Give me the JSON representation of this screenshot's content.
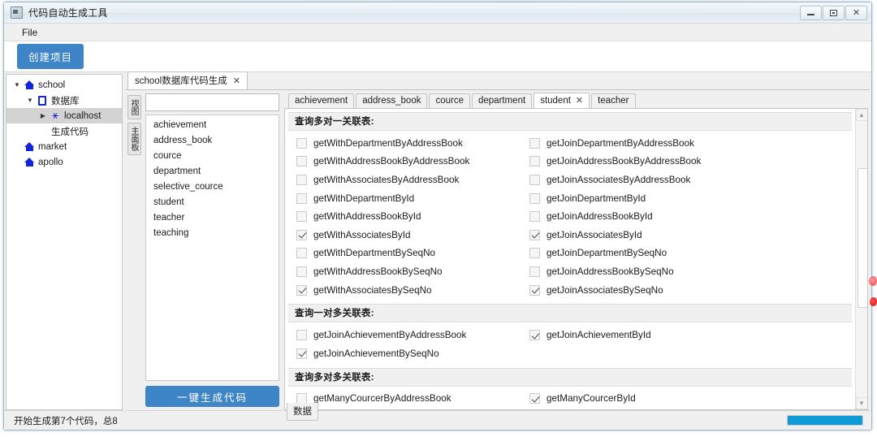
{
  "window": {
    "title": "代码自动生成工具",
    "icon": "app-icon",
    "controls": {
      "minimize": "—",
      "maximize": "□",
      "close": "✕"
    }
  },
  "menubar": {
    "items": [
      "File"
    ]
  },
  "toolbar": {
    "create_project_label": "创建项目"
  },
  "sidebar": {
    "items": [
      {
        "label": "school",
        "icon": "house-icon",
        "indent": 0,
        "twisty": "▼",
        "selected": false
      },
      {
        "label": "数据库",
        "icon": "database-icon",
        "indent": 1,
        "twisty": "▼",
        "selected": false
      },
      {
        "label": "localhost",
        "icon": "plug-icon",
        "indent": 2,
        "twisty": "▶",
        "selected": true
      },
      {
        "label": "生成代码",
        "icon": "none",
        "indent": 1,
        "twisty": "",
        "selected": false
      },
      {
        "label": "market",
        "icon": "house-icon",
        "indent": 0,
        "twisty": "",
        "selected": false
      },
      {
        "label": "apollo",
        "icon": "house-icon",
        "indent": 0,
        "twisty": "",
        "selected": false
      }
    ]
  },
  "doc_tab": {
    "label": "school数据库代码生成",
    "close": "✕"
  },
  "vertical_tabs": [
    "视图",
    "主面板"
  ],
  "table_list": {
    "search_value": "",
    "search_placeholder": "",
    "items": [
      "achievement",
      "address_book",
      "cource",
      "department",
      "selective_cource",
      "student",
      "teacher",
      "teaching"
    ],
    "generate_button_label": "一键生成代码"
  },
  "method_tabs": [
    {
      "label": "achievement",
      "active": false,
      "closable": false
    },
    {
      "label": "address_book",
      "active": false,
      "closable": false
    },
    {
      "label": "cource",
      "active": false,
      "closable": false
    },
    {
      "label": "department",
      "active": false,
      "closable": false
    },
    {
      "label": "student",
      "active": true,
      "closable": true,
      "close": "✕"
    },
    {
      "label": "teacher",
      "active": false,
      "closable": false
    }
  ],
  "method_sections": [
    {
      "header": "查询多对一关联表:",
      "rows": [
        {
          "left": {
            "label": "getWithDepartmentByAddressBook",
            "checked": false
          },
          "right": {
            "label": "getJoinDepartmentByAddressBook",
            "checked": false
          }
        },
        {
          "left": {
            "label": "getWithAddressBookByAddressBook",
            "checked": false
          },
          "right": {
            "label": "getJoinAddressBookByAddressBook",
            "checked": false
          }
        },
        {
          "left": {
            "label": "getWithAssociatesByAddressBook",
            "checked": false
          },
          "right": {
            "label": "getJoinAssociatesByAddressBook",
            "checked": false
          }
        },
        {
          "left": {
            "label": "getWithDepartmentById",
            "checked": false
          },
          "right": {
            "label": "getJoinDepartmentById",
            "checked": false
          }
        },
        {
          "left": {
            "label": "getWithAddressBookById",
            "checked": false
          },
          "right": {
            "label": "getJoinAddressBookById",
            "checked": false
          }
        },
        {
          "left": {
            "label": "getWithAssociatesById",
            "checked": true
          },
          "right": {
            "label": "getJoinAssociatesById",
            "checked": true
          }
        },
        {
          "left": {
            "label": "getWithDepartmentBySeqNo",
            "checked": false
          },
          "right": {
            "label": "getJoinDepartmentBySeqNo",
            "checked": false
          }
        },
        {
          "left": {
            "label": "getWithAddressBookBySeqNo",
            "checked": false
          },
          "right": {
            "label": "getJoinAddressBookBySeqNo",
            "checked": false
          }
        },
        {
          "left": {
            "label": "getWithAssociatesBySeqNo",
            "checked": true
          },
          "right": {
            "label": "getJoinAssociatesBySeqNo",
            "checked": true
          }
        }
      ]
    },
    {
      "header": "查询一对多关联表:",
      "rows": [
        {
          "left": {
            "label": "getJoinAchievementByAddressBook",
            "checked": false
          },
          "right": {
            "label": "getJoinAchievementById",
            "checked": true
          }
        },
        {
          "left": {
            "label": "getJoinAchievementBySeqNo",
            "checked": true
          },
          "right": {
            "label": "",
            "checked": false
          }
        }
      ]
    },
    {
      "header": "查询多对多关联表:",
      "rows": [
        {
          "left": {
            "label": "getManyCourcerByAddressBook",
            "checked": false
          },
          "right": {
            "label": "getManyCourcerById",
            "checked": true
          }
        }
      ]
    }
  ],
  "bottom_tab": {
    "label": "数据"
  },
  "statusbar": {
    "text": "开始生成第7个代码，总8",
    "progress_percent": 100,
    "progress_color": "#0f9bd7"
  },
  "scrollbar": {
    "up": "▲",
    "down": "▼"
  }
}
